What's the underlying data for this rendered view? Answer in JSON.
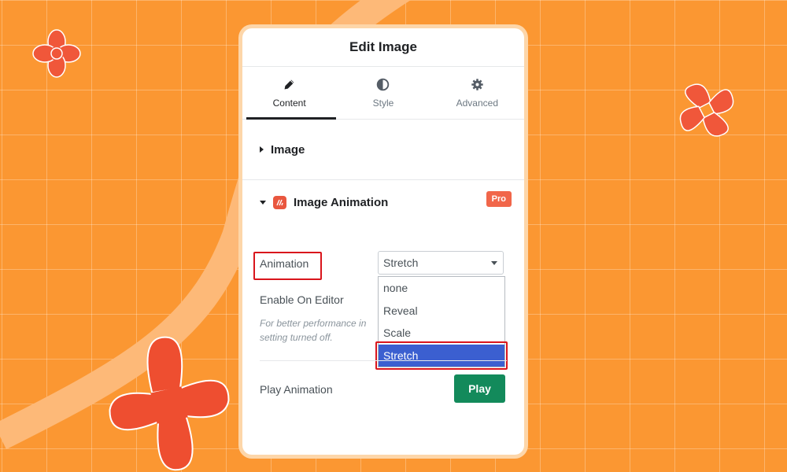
{
  "panel": {
    "title": "Edit Image",
    "tabs": [
      {
        "label": "Content",
        "icon": "pencil-icon",
        "active": true
      },
      {
        "label": "Style",
        "icon": "half-circle-icon",
        "active": false
      },
      {
        "label": "Advanced",
        "icon": "gear-icon",
        "active": false
      }
    ],
    "sections": {
      "image": {
        "label": "Image",
        "expanded": false
      },
      "animation": {
        "label": "Image Animation",
        "expanded": true,
        "badge": "Pro"
      }
    },
    "fields": {
      "animation_label": "Animation",
      "animation_value": "Stretch",
      "animation_options": [
        "none",
        "Reveal",
        "Scale",
        "Stretch"
      ],
      "enable_on_editor_label": "Enable On Editor",
      "note_line1": "For better performance in",
      "note_line2": "setting turned off.",
      "play_label": "Play Animation",
      "play_button": "Play"
    }
  },
  "colors": {
    "background": "#fb9732",
    "selected_option": "#3b5fd0",
    "highlight": "#d9151c",
    "pro_badge": "#f1664a",
    "play_button": "#138a5b"
  }
}
